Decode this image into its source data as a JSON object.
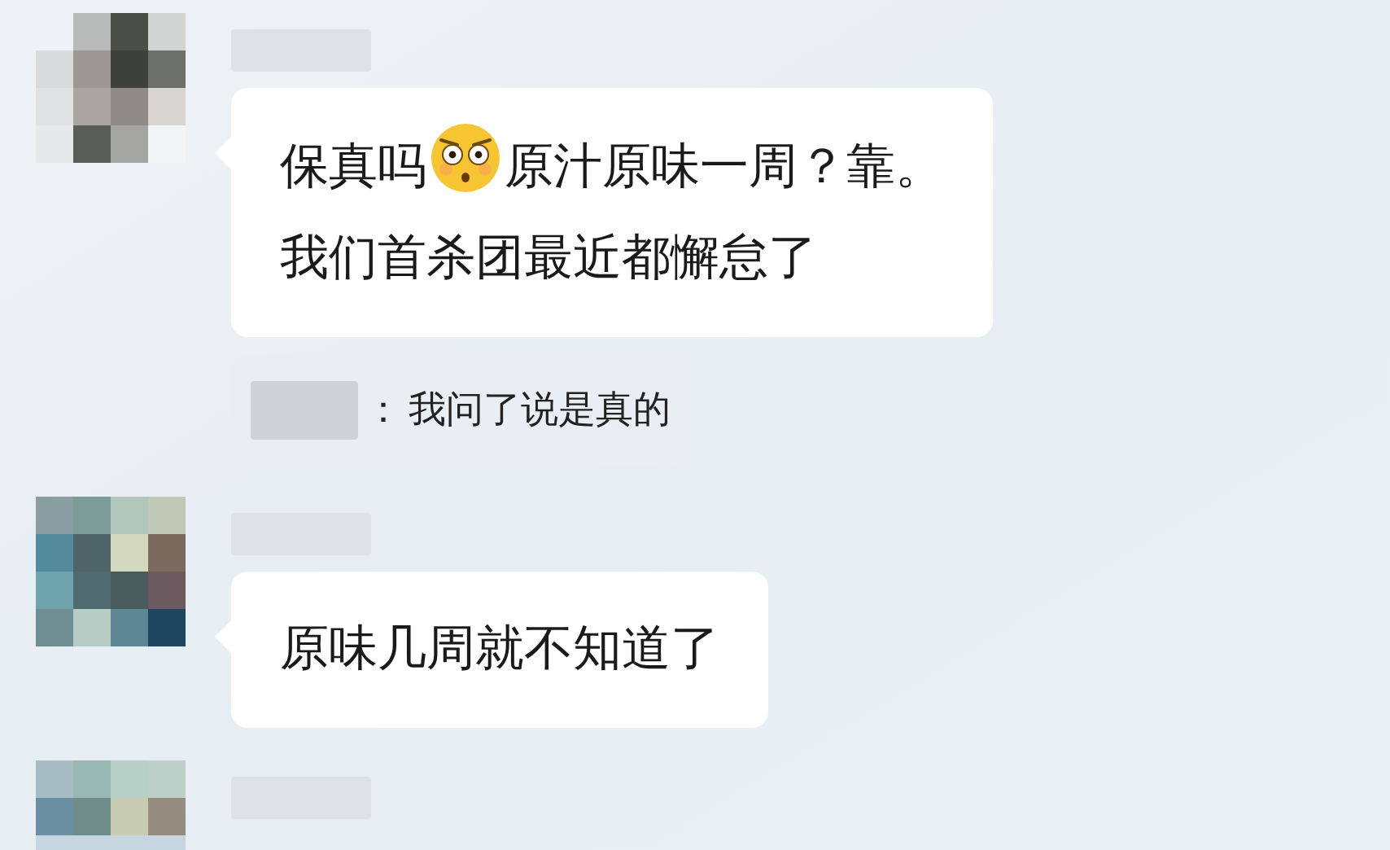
{
  "groups": [
    {
      "kind": "incoming",
      "messages": [
        {
          "kind": "bubble",
          "lines": [
            [
              {
                "kind": "text",
                "text": "保真吗"
              },
              {
                "kind": "emoji"
              },
              {
                "kind": "text",
                "text": "原汁原味一周？靠。"
              }
            ],
            [
              {
                "kind": "text",
                "text": "我们首杀团最近都懈怠了"
              }
            ]
          ]
        },
        {
          "kind": "quote",
          "separator": "：",
          "text": "我问了说是真的"
        }
      ]
    },
    {
      "kind": "incoming",
      "messages": [
        {
          "kind": "bubble",
          "lines": [
            [
              {
                "kind": "text",
                "text": "原味几周就不知道了"
              }
            ]
          ]
        }
      ]
    },
    {
      "kind": "incoming"
    }
  ]
}
